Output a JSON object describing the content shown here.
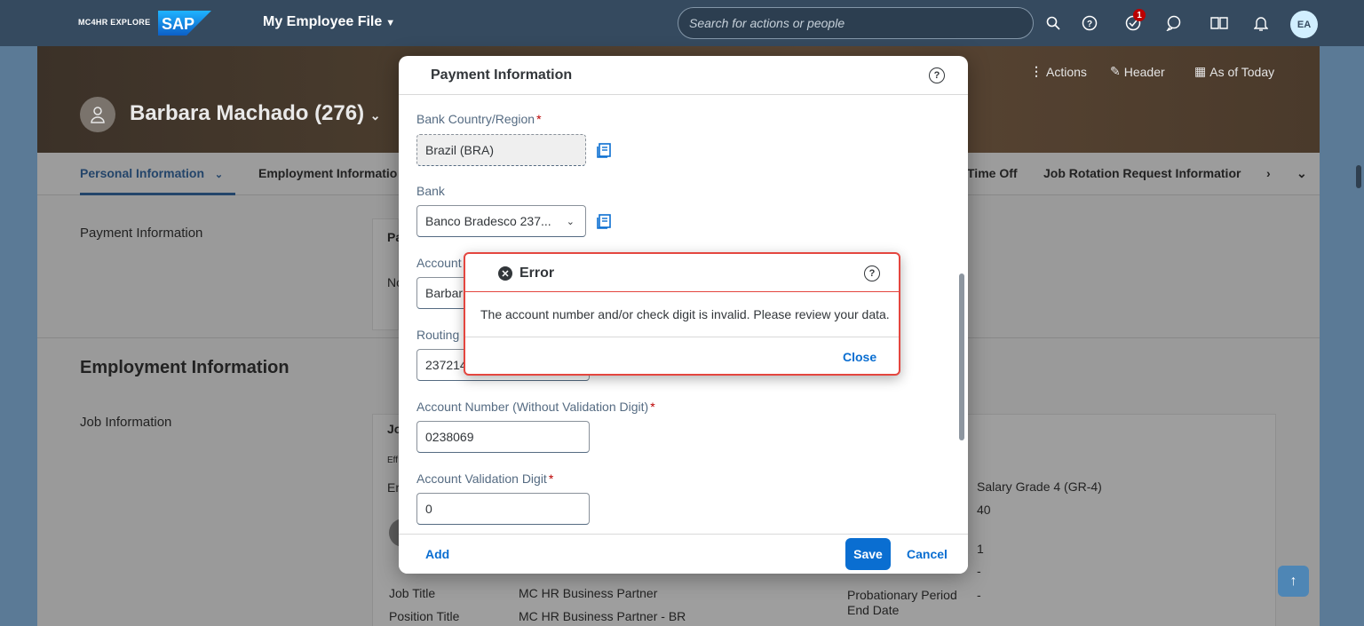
{
  "shell": {
    "brand_text": "MC4HR EXPLORE",
    "logo": "SAP",
    "app_title": "My Employee File",
    "search_placeholder": "Search for actions or people",
    "notification_count": "1",
    "user_initials": "EA",
    "icons": [
      "search-icon",
      "help-icon",
      "todo-icon",
      "joule-icon",
      "learning-icon",
      "bell-icon"
    ]
  },
  "hero": {
    "name": "Barbara Machado (276)",
    "actions_label": "Actions",
    "header_label": "Header",
    "as_of_label": "As of Today"
  },
  "tabs": [
    {
      "label": "Personal Information"
    },
    {
      "label": "Employment Informatio"
    },
    {
      "label": "Time Off"
    },
    {
      "label": "Job Rotation Request Informatior"
    }
  ],
  "background": {
    "payment_label": "Payment Information",
    "payment_card_head": "Pa",
    "payment_card_text": "No",
    "employment_title": "Employment Information",
    "job_info_label": "Job Information",
    "job_card_head": "Jo",
    "eff_label": "Eff",
    "emp_label": "Er",
    "salary_grade": "Salary Grade 4 (GR-4)",
    "hours": "40",
    "one": "1",
    "dash1": "-",
    "dash2": "-",
    "job_title_label": "Job Title",
    "job_title_value": "MC HR Business Partner",
    "position_title_label": "Position Title",
    "position_title_value": "MC HR Business Partner - BR",
    "probationary_label": "Probationary Period",
    "end_date_label": "End Date"
  },
  "dialog": {
    "title": "Payment Information",
    "fields": {
      "bank_country_label": "Bank Country/Region",
      "bank_country_value": "Brazil (BRA)",
      "bank_label": "Bank",
      "bank_value": "Banco Bradesco 237...",
      "account_label": "Account",
      "account_value": "Barbar",
      "routing_label": "Routing",
      "routing_value": "237214",
      "account_number_label": "Account Number (Without Validation Digit)",
      "account_number_value": "0238069",
      "validation_digit_label": "Account Validation Digit",
      "validation_digit_value": "0"
    },
    "add_label": "Add",
    "save_label": "Save",
    "cancel_label": "Cancel"
  },
  "error": {
    "title": "Error",
    "message": "The account number and/or check digit is invalid. Please review your data.",
    "close_label": "Close"
  }
}
